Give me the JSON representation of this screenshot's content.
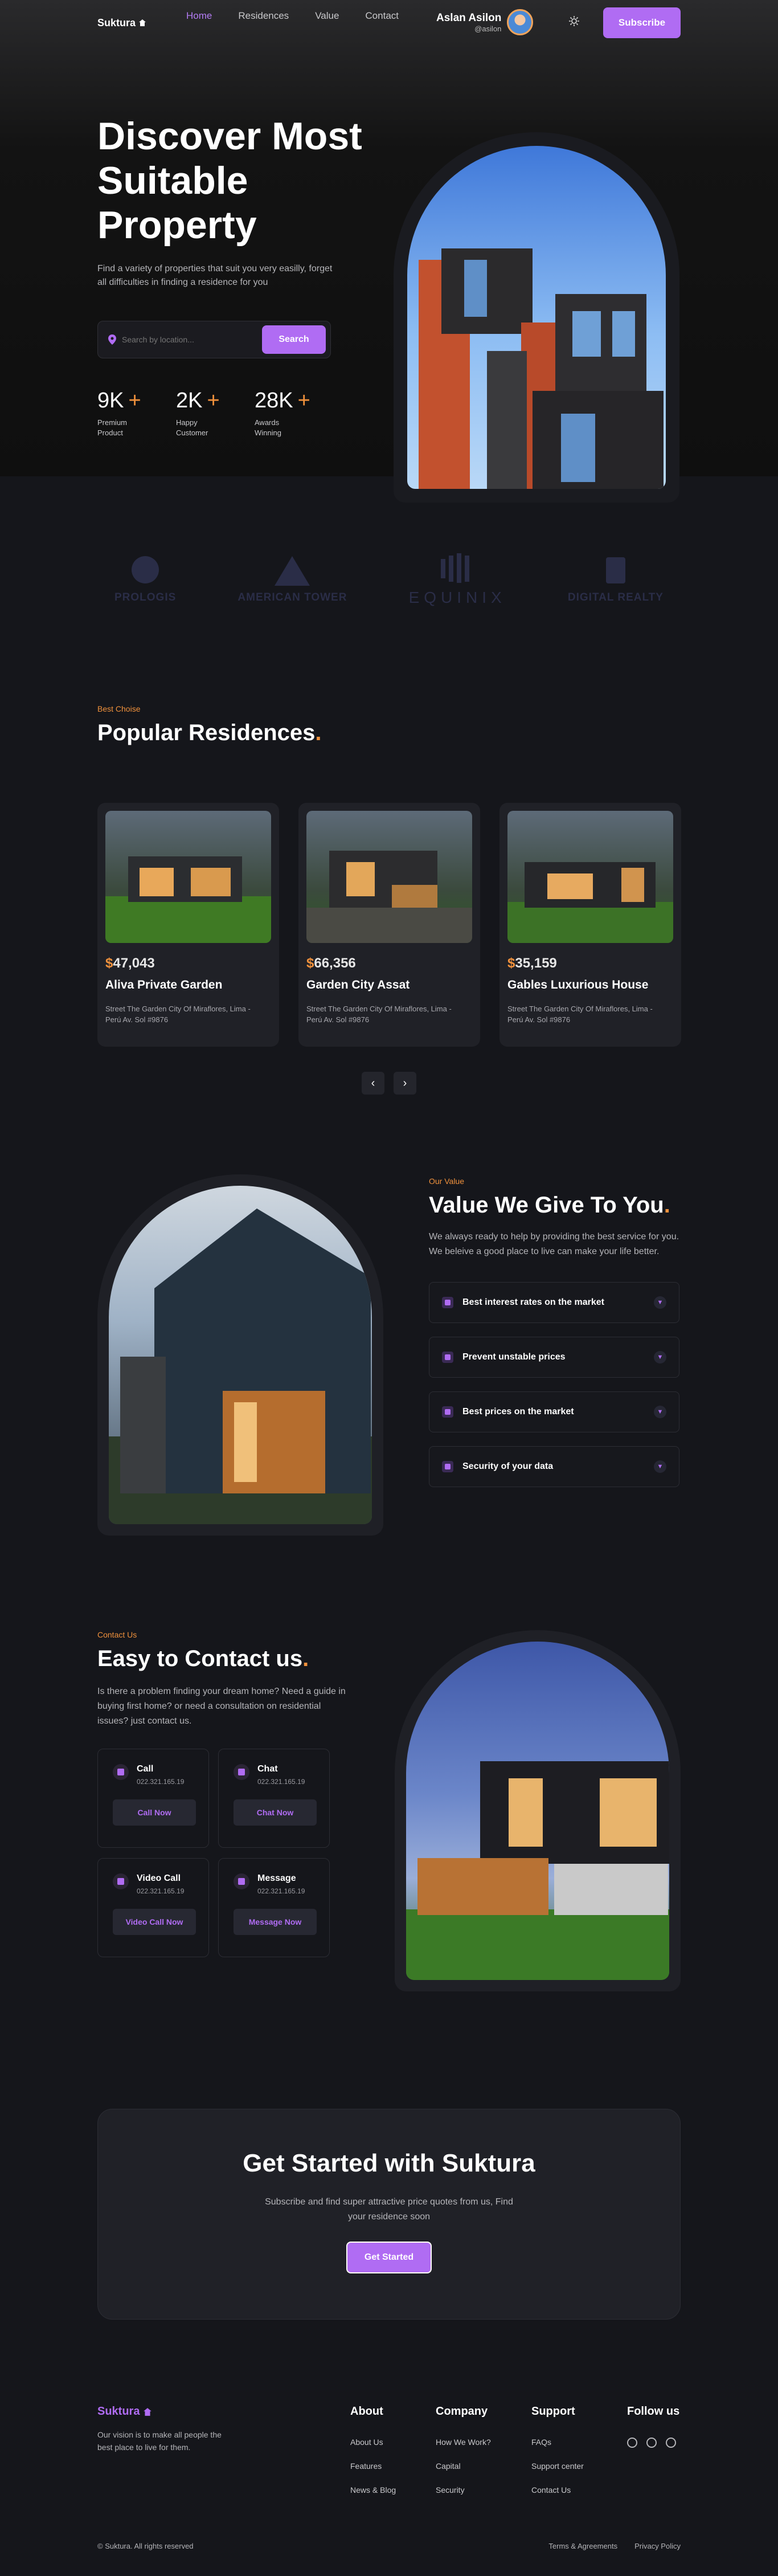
{
  "nav": {
    "logo": "Suktura",
    "links": [
      "Home",
      "Residences",
      "Value",
      "Contact"
    ],
    "active_link": "Home",
    "user_name": "Aslan Asilon",
    "user_handle": "@asilon",
    "subscribe_label": "Subscribe"
  },
  "hero": {
    "title": "Discover Most Suitable Property",
    "subtitle": "Find a variety of properties that suit you very easilly, forget all difficulties in finding a residence for you",
    "search_placeholder": "Search by location...",
    "search_label": "Search",
    "stats": [
      {
        "value": "9K",
        "plus": "+",
        "label": "Premium Product"
      },
      {
        "value": "2K",
        "plus": "+",
        "label": "Happy Customer"
      },
      {
        "value": "28K",
        "plus": "+",
        "label": "Awards Winning"
      }
    ]
  },
  "partners": [
    "PROLOGIS",
    "AMERICAN TOWER",
    "EQUINIX",
    "DIGITAL REALTY"
  ],
  "residences": {
    "eyebrow": "Best Choise",
    "title": "Popular Residences",
    "dot": ".",
    "cards": [
      {
        "currency": "$",
        "price": "47,043",
        "name": "Aliva Private Garden",
        "address": "Street The Garden City Of Miraflores, Lima - Perú Av. Sol #9876"
      },
      {
        "currency": "$",
        "price": "66,356",
        "name": "Garden City Assat",
        "address": "Street The Garden City Of Miraflores, Lima - Perú Av. Sol #9876"
      },
      {
        "currency": "$",
        "price": "35,159",
        "name": "Gables Luxurious House",
        "address": "Street The Garden City Of Miraflores, Lima - Perú Av. Sol #9876"
      }
    ],
    "prev_arrow": "‹",
    "next_arrow": "›"
  },
  "value": {
    "eyebrow": "Our Value",
    "title": "Value We Give To You",
    "dot": ".",
    "description": "We always ready to help by providing the best service for you. We beleive a good place to live can make your life better.",
    "items": [
      {
        "label": "Best interest rates on the market",
        "icon": "location-icon"
      },
      {
        "label": "Prevent unstable prices",
        "icon": "shield-icon"
      },
      {
        "label": "Best prices on the market",
        "icon": "chart-icon"
      },
      {
        "label": "Security of your data",
        "icon": "lock-icon"
      }
    ]
  },
  "contact": {
    "eyebrow": "Contact Us",
    "title": "Easy to Contact us",
    "dot": ".",
    "description": "Is there a problem finding your dream home? Need a guide in buying first home? or need a consultation on residential issues? just contact us.",
    "boxes": [
      {
        "name": "Call",
        "number": "022.321.165.19",
        "button": "Call Now",
        "icon": "phone-icon"
      },
      {
        "name": "Chat",
        "number": "022.321.165.19",
        "button": "Chat Now",
        "icon": "chat-icon"
      },
      {
        "name": "Video Call",
        "number": "022.321.165.19",
        "button": "Video Call Now",
        "icon": "video-icon"
      },
      {
        "name": "Message",
        "number": "022.321.165.19",
        "button": "Message Now",
        "icon": "mail-icon"
      }
    ]
  },
  "cta": {
    "title": "Get Started with Suktura",
    "subtitle": "Subscribe and find super attractive price quotes from us, Find your residence soon",
    "button": "Get Started"
  },
  "footer": {
    "logo": "Suktura",
    "vision": "Our vision is to make all people the best place to live for them.",
    "columns": [
      {
        "title": "About",
        "links": [
          "About Us",
          "Features",
          "News & Blog"
        ]
      },
      {
        "title": "Company",
        "links": [
          "How We Work?",
          "Capital",
          "Security"
        ]
      },
      {
        "title": "Support",
        "links": [
          "FAQs",
          "Support center",
          "Contact Us"
        ]
      }
    ],
    "follow_title": "Follow us",
    "social": [
      "facebook-icon",
      "instagram-icon",
      "pinterest-icon"
    ],
    "copyright": "© Suktura. All rights reserved",
    "terms": "Terms & Agreements",
    "privacy": "Privacy Policy"
  },
  "colors": {
    "accent": "#b06cf3",
    "orange": "#f0913c",
    "background": "#15161b"
  }
}
